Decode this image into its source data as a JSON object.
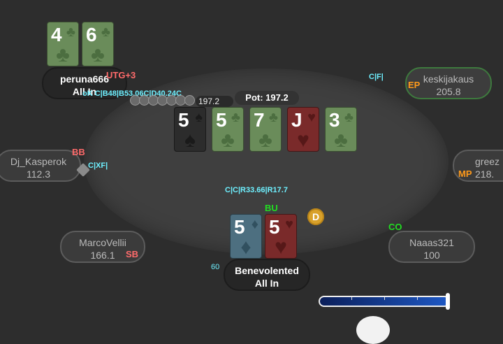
{
  "pot": {
    "label": "Pot: 197.2"
  },
  "bet": {
    "amount": "197.2"
  },
  "dealer_button": "D",
  "board": [
    {
      "rank": "5",
      "suit": "spade"
    },
    {
      "rank": "5",
      "suit": "club"
    },
    {
      "rank": "7",
      "suit": "club"
    },
    {
      "rank": "J",
      "suit": "heart"
    },
    {
      "rank": "3",
      "suit": "club"
    }
  ],
  "players": {
    "peruna666": {
      "name": "peruna666",
      "stack": "All In",
      "position": "UTG+3",
      "actions": "oK C|B48|B53.06C|D40.24C",
      "cards": [
        {
          "rank": "4",
          "suit": "club"
        },
        {
          "rank": "6",
          "suit": "club"
        }
      ]
    },
    "keskijakaus": {
      "name": "keskijakaus",
      "stack": "205.8",
      "position": "EP",
      "actions": "C|F|"
    },
    "dj_kasperok": {
      "name": "Dj_Kasperok",
      "stack": "112.3",
      "position": "BB",
      "actions": "C|XF|"
    },
    "greez": {
      "name": "greez",
      "stack": "218.",
      "position": "MP"
    },
    "marcovellii": {
      "name": "MarcoVellii",
      "stack": "166.1",
      "position": "SB"
    },
    "naaas321": {
      "name": "Naaas321",
      "stack": "100",
      "position": "CO"
    },
    "benevolented": {
      "name": "Benevolented",
      "stack": "All In",
      "position": "BU",
      "actions": "C|C|R33.66|R17.7",
      "seat": "60",
      "cards": [
        {
          "rank": "5",
          "suit": "diamond"
        },
        {
          "rank": "5",
          "suit": "heart"
        }
      ]
    }
  },
  "suit_glyphs": {
    "spade": "♠",
    "club": "♣",
    "heart": "♥",
    "diamond": "♦"
  },
  "colors": {
    "felt": "#3f3f3f",
    "background": "#2d2d2d",
    "action_text": "#6ef0ff",
    "position_red": "#ff6b6b",
    "position_orange": "#ff9a1a",
    "position_green": "#22dd22",
    "dealer": "#d9a12a"
  },
  "bet_slider": {
    "fraction": 1.0
  }
}
